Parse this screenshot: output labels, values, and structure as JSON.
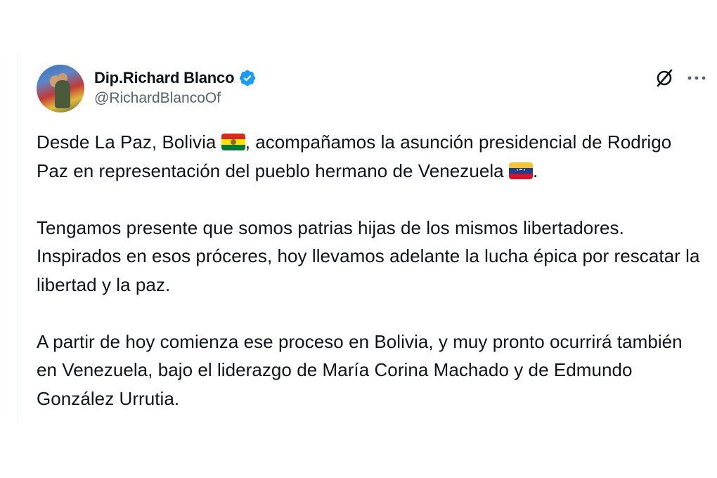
{
  "post": {
    "author": {
      "display_name": "Dip.Richard Blanco",
      "handle": "@RichardBlancoOf",
      "verified_color": "#1d9bf0"
    },
    "actions": {
      "grok_icon": "grok-icon",
      "more_icon": "more-horizontal-icon"
    },
    "paragraphs": [
      {
        "part1": "Desde La Paz, Bolivia ",
        "part2": ", acompañamos la asunción presidencial de Rodrigo Paz en representación del pueblo hermano de Venezuela ",
        "part3": "."
      },
      {
        "text": "Tengamos presente que somos patrias hijas de los mismos libertadores. Inspirados en esos próceres, hoy llevamos adelante la lucha épica por rescatar la libertad y la paz."
      },
      {
        "text": "A partir de hoy comienza ese proceso en Bolivia, y muy pronto ocurrirá también en Venezuela, bajo el liderazgo de María Corina Machado y de Edmundo González Urrutia."
      }
    ]
  }
}
